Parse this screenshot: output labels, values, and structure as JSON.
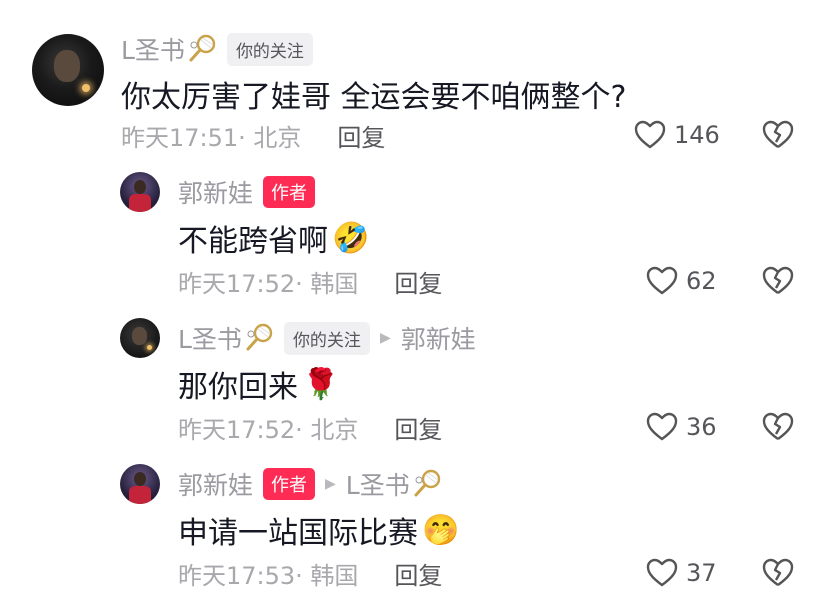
{
  "comments": [
    {
      "name": "L圣书",
      "badge": "你的关注",
      "text": "你太厉害了娃哥 全运会要不咱俩整个?",
      "time_location": "昨天17:51· 北京",
      "reply_label": "回复",
      "likes": "146",
      "icons": [
        "racket-emoji-icon",
        "heart-icon",
        "broken-heart-icon"
      ]
    },
    {
      "name": "郭新娃",
      "badge": "作者",
      "text": "不能跨省啊",
      "emoji": "🤣",
      "time_location": "昨天17:52· 韩国",
      "reply_label": "回复",
      "likes": "62"
    },
    {
      "name": "L圣书",
      "badge": "你的关注",
      "reply_to": "郭新娃",
      "text": "那你回来",
      "emoji": "🌹",
      "time_location": "昨天17:52· 北京",
      "reply_label": "回复",
      "likes": "36"
    },
    {
      "name": "郭新娃",
      "badge": "作者",
      "reply_to": "L圣书",
      "text": "申请一站国际比赛",
      "emoji": "🤭",
      "time_location": "昨天17:53· 韩国",
      "reply_label": "回复",
      "likes": "37"
    }
  ],
  "colors": {
    "author_badge": "#fe2c55",
    "follow_badge_bg": "#f0f0f2",
    "secondary_text": "#9a9aa0",
    "primary_text": "#161823"
  }
}
